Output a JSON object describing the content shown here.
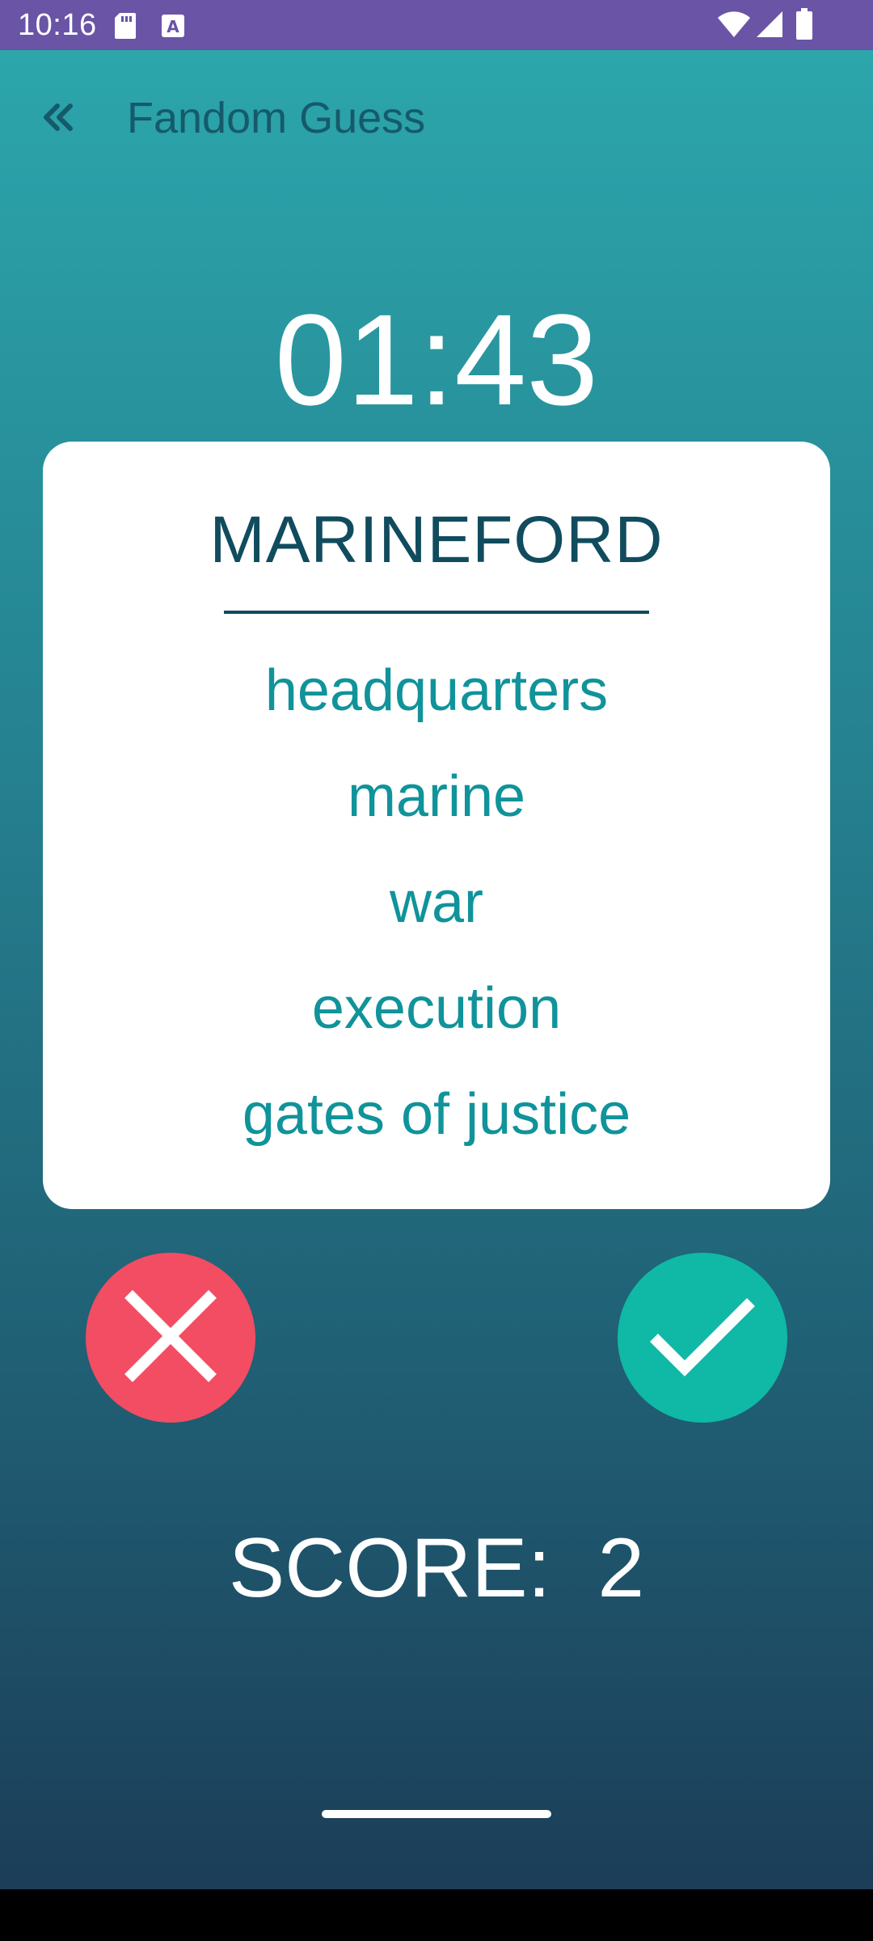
{
  "status_bar": {
    "time": "10:16",
    "icons": [
      "sd-card-icon",
      "keyboard-a-icon",
      "wifi-icon",
      "signal-icon",
      "battery-icon"
    ]
  },
  "app_bar": {
    "title": "Fandom Guess",
    "back_icon": "double-chevron-left-icon"
  },
  "game": {
    "timer": "01:43",
    "word": "MARINEFORD",
    "forbidden_words": [
      "headquarters",
      "marine",
      "war",
      "execution",
      "gates of justice"
    ],
    "score_text": "SCORE:  2"
  },
  "buttons": {
    "wrong_icon": "close-icon",
    "correct_icon": "check-icon"
  },
  "colors": {
    "status_bar": "#6a54a6",
    "gradient_top": "#2ca8ad",
    "gradient_bottom": "#1b3a55",
    "wrong": "#f24d62",
    "correct": "#10b8a6",
    "word": "#104b5e",
    "forbidden": "#10939a"
  }
}
